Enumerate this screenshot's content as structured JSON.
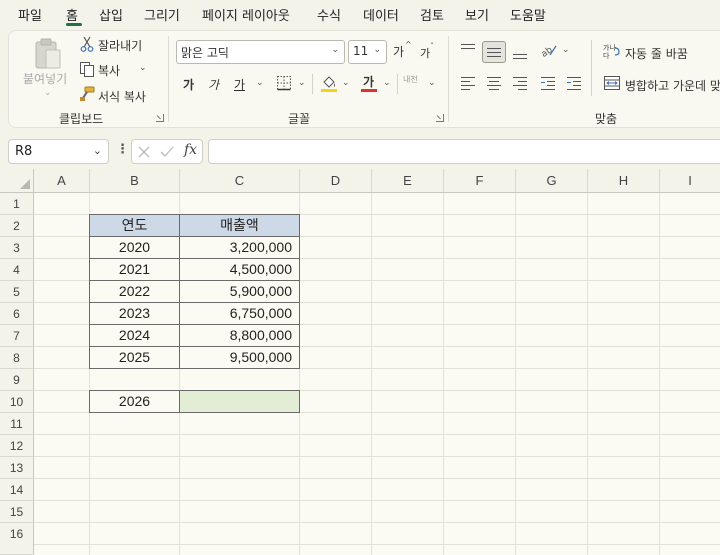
{
  "menu": {
    "items": [
      "파일",
      "홈",
      "삽입",
      "그리기",
      "페이지 레이아웃",
      "수식",
      "데이터",
      "검토",
      "보기",
      "도움말"
    ],
    "active": "홈"
  },
  "ribbon": {
    "clipboard": {
      "paste_label": "붙여넣기",
      "cut_label": "잘라내기",
      "copy_label": "복사",
      "format_painter_label": "서식 복사",
      "group_label": "클립보드"
    },
    "font": {
      "font_name": "맑은 고딕",
      "font_size": "11",
      "grow_label": "가",
      "shrink_label": "가",
      "bold_label": "가",
      "italic_label": "가",
      "underline_label": "가",
      "font_color_label": "가",
      "phonetic_label": "내천",
      "group_label": "글꼴"
    },
    "alignment": {
      "wrap_text_label": "자동 줄 바꿈",
      "merge_center_label": "병합하고 가운데 맞",
      "group_label": "맞춤"
    }
  },
  "formula_bar": {
    "name_box": "R8",
    "fx_label": "fx",
    "formula": ""
  },
  "grid": {
    "columns": [
      "A",
      "B",
      "C",
      "D",
      "E",
      "F",
      "G",
      "H",
      "I"
    ],
    "rows": [
      "1",
      "2",
      "3",
      "4",
      "5",
      "6",
      "7",
      "8",
      "9",
      "10",
      "11",
      "12",
      "13",
      "14",
      "15",
      "16"
    ],
    "table": {
      "header": [
        "연도",
        "매출액"
      ],
      "rows": [
        [
          "2020",
          "3,200,000"
        ],
        [
          "2021",
          "4,500,000"
        ],
        [
          "2022",
          "5,900,000"
        ],
        [
          "2023",
          "6,750,000"
        ],
        [
          "2024",
          "8,800,000"
        ],
        [
          "2025",
          "9,500,000"
        ]
      ]
    },
    "forecast": {
      "year": "2026",
      "value": ""
    }
  },
  "colors": {
    "accent": "#1e7145",
    "table_header_fill": "#cdd9e6",
    "forecast_fill": "#e3edd6",
    "fill_color_swatch": "#f2d21b",
    "font_color_swatch": "#e03030"
  },
  "icons": [
    "paste-icon",
    "cut-icon",
    "copy-icon",
    "format-painter-icon",
    "border-icon",
    "fill-color-icon",
    "font-color-icon",
    "align-top-icon",
    "align-middle-icon",
    "align-bottom-icon",
    "orientation-icon",
    "align-left-icon",
    "align-center-icon",
    "align-right-icon",
    "decrease-indent-icon",
    "increase-indent-icon",
    "wrap-text-icon",
    "merge-center-icon",
    "cancel-icon",
    "enter-icon"
  ]
}
